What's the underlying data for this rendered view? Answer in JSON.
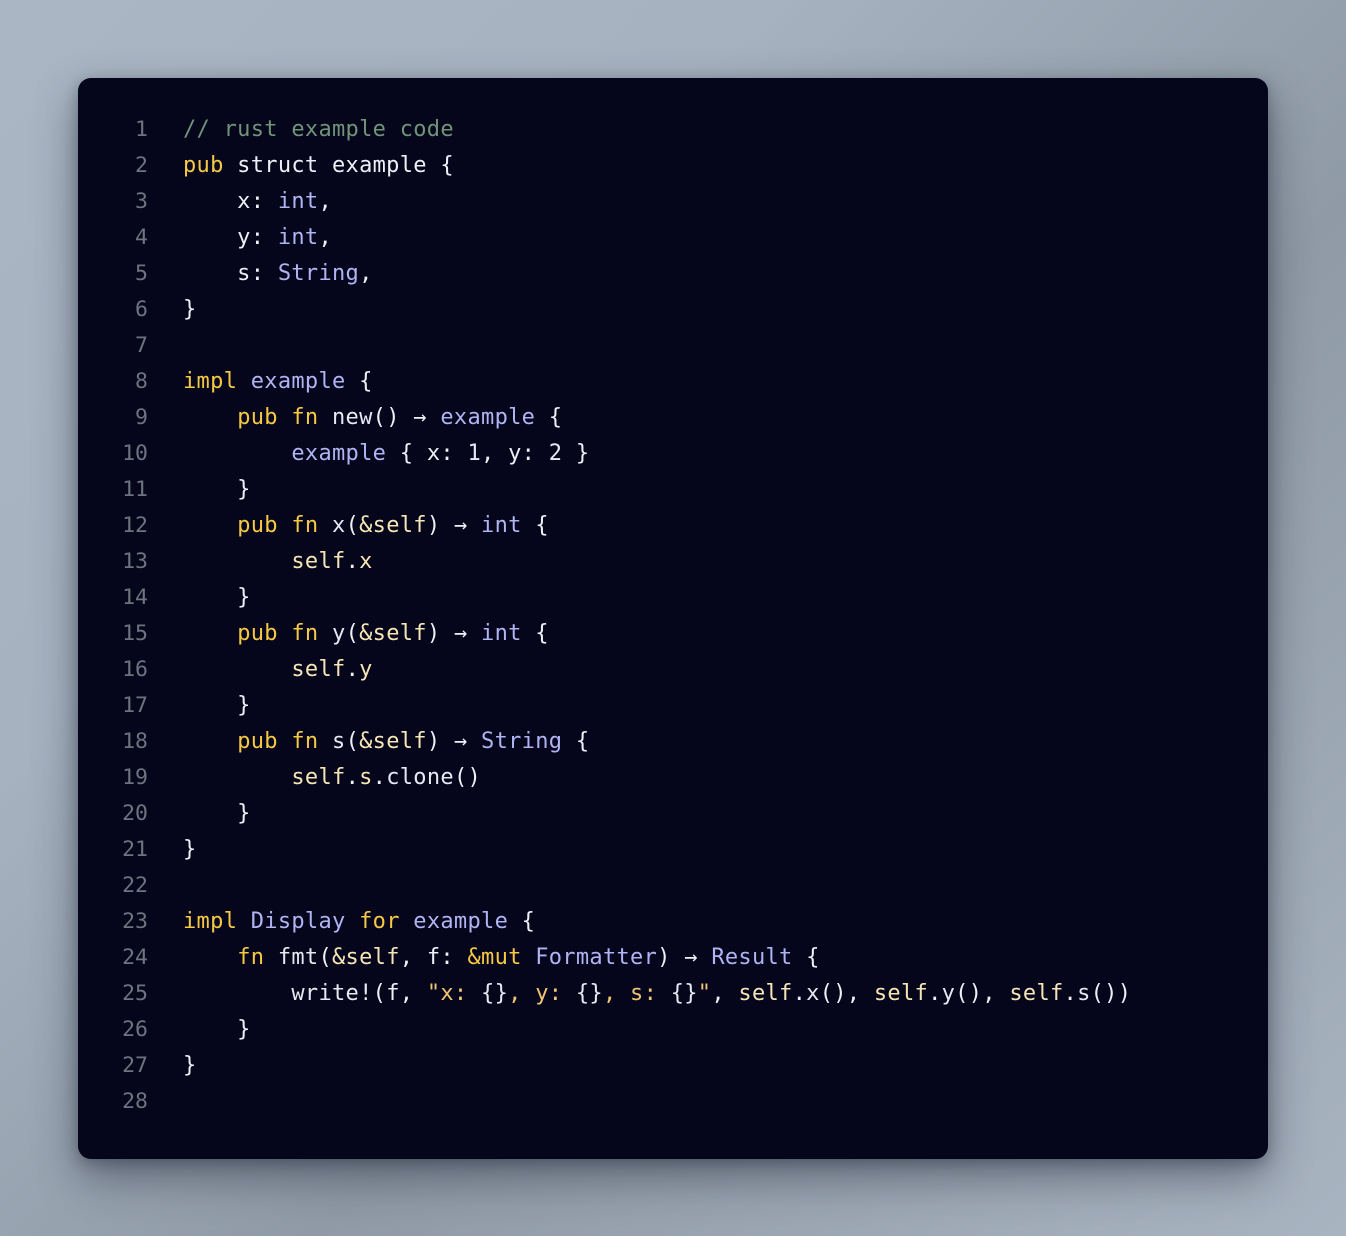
{
  "editor": {
    "language": "rust",
    "background": "#05051c",
    "page_background": "#a6b2c0",
    "gutter_color": "#6e747f",
    "total_lines": 28
  },
  "palette": {
    "comment": "#6f9478",
    "keyword": "#f6c944",
    "type": "#b0b4f2",
    "function": "#cdf3dc",
    "self": "#f6e6b6",
    "plain": "#eef0f6",
    "number": "#d9a521",
    "string": "#f0c674",
    "brace_placeholder": "#ffd040"
  },
  "lines": [
    {
      "n": "1",
      "tokens": [
        {
          "t": "// rust example code",
          "c": "comment"
        }
      ]
    },
    {
      "n": "2",
      "tokens": [
        {
          "t": "pub",
          "c": "keyword"
        },
        {
          "t": " struct example {",
          "c": "plain"
        }
      ]
    },
    {
      "n": "3",
      "tokens": [
        {
          "t": "    x: ",
          "c": "plain"
        },
        {
          "t": "int",
          "c": "type"
        },
        {
          "t": ",",
          "c": "plain"
        }
      ]
    },
    {
      "n": "4",
      "tokens": [
        {
          "t": "    y: ",
          "c": "plain"
        },
        {
          "t": "int",
          "c": "type"
        },
        {
          "t": ",",
          "c": "plain"
        }
      ]
    },
    {
      "n": "5",
      "tokens": [
        {
          "t": "    s: ",
          "c": "plain"
        },
        {
          "t": "String",
          "c": "type"
        },
        {
          "t": ",",
          "c": "plain"
        }
      ]
    },
    {
      "n": "6",
      "tokens": [
        {
          "t": "}",
          "c": "plain"
        }
      ]
    },
    {
      "n": "7",
      "tokens": []
    },
    {
      "n": "8",
      "tokens": [
        {
          "t": "impl",
          "c": "keyword"
        },
        {
          "t": " ",
          "c": "plain"
        },
        {
          "t": "example",
          "c": "type"
        },
        {
          "t": " {",
          "c": "plain"
        }
      ]
    },
    {
      "n": "9",
      "tokens": [
        {
          "t": "    ",
          "c": "plain"
        },
        {
          "t": "pub fn",
          "c": "keyword"
        },
        {
          "t": " ",
          "c": "plain"
        },
        {
          "t": "new",
          "c": "function"
        },
        {
          "t": "() ",
          "c": "plain"
        },
        {
          "t": "→",
          "c": "plain"
        },
        {
          "t": " ",
          "c": "plain"
        },
        {
          "t": "example",
          "c": "type"
        },
        {
          "t": " {",
          "c": "plain"
        }
      ]
    },
    {
      "n": "10",
      "tokens": [
        {
          "t": "        ",
          "c": "plain"
        },
        {
          "t": "example",
          "c": "type"
        },
        {
          "t": " { x: ",
          "c": "plain"
        },
        {
          "t": "1",
          "c": "number"
        },
        {
          "t": ", y: ",
          "c": "plain"
        },
        {
          "t": "2",
          "c": "number"
        },
        {
          "t": " }",
          "c": "plain"
        }
      ]
    },
    {
      "n": "11",
      "tokens": [
        {
          "t": "    }",
          "c": "plain"
        }
      ]
    },
    {
      "n": "12",
      "tokens": [
        {
          "t": "    ",
          "c": "plain"
        },
        {
          "t": "pub fn",
          "c": "keyword"
        },
        {
          "t": " ",
          "c": "plain"
        },
        {
          "t": "x",
          "c": "function"
        },
        {
          "t": "(",
          "c": "plain"
        },
        {
          "t": "&self",
          "c": "self"
        },
        {
          "t": ") ",
          "c": "plain"
        },
        {
          "t": "→",
          "c": "plain"
        },
        {
          "t": " ",
          "c": "plain"
        },
        {
          "t": "int",
          "c": "type"
        },
        {
          "t": " {",
          "c": "plain"
        }
      ]
    },
    {
      "n": "13",
      "tokens": [
        {
          "t": "        ",
          "c": "plain"
        },
        {
          "t": "self",
          "c": "self"
        },
        {
          "t": ".",
          "c": "plain"
        },
        {
          "t": "x",
          "c": "self"
        }
      ]
    },
    {
      "n": "14",
      "tokens": [
        {
          "t": "    }",
          "c": "plain"
        }
      ]
    },
    {
      "n": "15",
      "tokens": [
        {
          "t": "    ",
          "c": "plain"
        },
        {
          "t": "pub fn",
          "c": "keyword"
        },
        {
          "t": " ",
          "c": "plain"
        },
        {
          "t": "y",
          "c": "function"
        },
        {
          "t": "(",
          "c": "plain"
        },
        {
          "t": "&self",
          "c": "self"
        },
        {
          "t": ") ",
          "c": "plain"
        },
        {
          "t": "→",
          "c": "plain"
        },
        {
          "t": " ",
          "c": "plain"
        },
        {
          "t": "int",
          "c": "type"
        },
        {
          "t": " {",
          "c": "plain"
        }
      ]
    },
    {
      "n": "16",
      "tokens": [
        {
          "t": "        ",
          "c": "plain"
        },
        {
          "t": "self",
          "c": "self"
        },
        {
          "t": ".",
          "c": "plain"
        },
        {
          "t": "y",
          "c": "self"
        }
      ]
    },
    {
      "n": "17",
      "tokens": [
        {
          "t": "    }",
          "c": "plain"
        }
      ]
    },
    {
      "n": "18",
      "tokens": [
        {
          "t": "    ",
          "c": "plain"
        },
        {
          "t": "pub fn",
          "c": "keyword"
        },
        {
          "t": " ",
          "c": "plain"
        },
        {
          "t": "s",
          "c": "function"
        },
        {
          "t": "(",
          "c": "plain"
        },
        {
          "t": "&self",
          "c": "self"
        },
        {
          "t": ") ",
          "c": "plain"
        },
        {
          "t": "→",
          "c": "plain"
        },
        {
          "t": " ",
          "c": "plain"
        },
        {
          "t": "String",
          "c": "type"
        },
        {
          "t": " {",
          "c": "plain"
        }
      ]
    },
    {
      "n": "19",
      "tokens": [
        {
          "t": "        ",
          "c": "plain"
        },
        {
          "t": "self",
          "c": "self"
        },
        {
          "t": ".",
          "c": "plain"
        },
        {
          "t": "s",
          "c": "self"
        },
        {
          "t": ".",
          "c": "plain"
        },
        {
          "t": "clone",
          "c": "function"
        },
        {
          "t": "()",
          "c": "plain"
        }
      ]
    },
    {
      "n": "20",
      "tokens": [
        {
          "t": "    }",
          "c": "plain"
        }
      ]
    },
    {
      "n": "21",
      "tokens": [
        {
          "t": "}",
          "c": "plain"
        }
      ]
    },
    {
      "n": "22",
      "tokens": []
    },
    {
      "n": "23",
      "tokens": [
        {
          "t": "impl",
          "c": "keyword"
        },
        {
          "t": " ",
          "c": "plain"
        },
        {
          "t": "Display",
          "c": "type"
        },
        {
          "t": " ",
          "c": "plain"
        },
        {
          "t": "for",
          "c": "keyword"
        },
        {
          "t": " ",
          "c": "plain"
        },
        {
          "t": "example",
          "c": "type"
        },
        {
          "t": " {",
          "c": "plain"
        }
      ]
    },
    {
      "n": "24",
      "tokens": [
        {
          "t": "    ",
          "c": "plain"
        },
        {
          "t": "fn",
          "c": "keyword"
        },
        {
          "t": " ",
          "c": "plain"
        },
        {
          "t": "fmt",
          "c": "function"
        },
        {
          "t": "(",
          "c": "plain"
        },
        {
          "t": "&self",
          "c": "self"
        },
        {
          "t": ", f: ",
          "c": "plain"
        },
        {
          "t": "&mut",
          "c": "keyword"
        },
        {
          "t": " ",
          "c": "plain"
        },
        {
          "t": "Formatter",
          "c": "type"
        },
        {
          "t": ") ",
          "c": "plain"
        },
        {
          "t": "→",
          "c": "plain"
        },
        {
          "t": " ",
          "c": "plain"
        },
        {
          "t": "Result",
          "c": "type"
        },
        {
          "t": " {",
          "c": "plain"
        }
      ]
    },
    {
      "n": "25",
      "tokens": [
        {
          "t": "        ",
          "c": "plain"
        },
        {
          "t": "write!",
          "c": "function"
        },
        {
          "t": "(f, ",
          "c": "plain"
        },
        {
          "t": "\"x: ",
          "c": "string"
        },
        {
          "t": "{}",
          "c": "brace_placeholder"
        },
        {
          "t": ", y: ",
          "c": "string"
        },
        {
          "t": "{}",
          "c": "brace_placeholder"
        },
        {
          "t": ", s: ",
          "c": "string"
        },
        {
          "t": "{}",
          "c": "brace_placeholder"
        },
        {
          "t": "\"",
          "c": "string"
        },
        {
          "t": ", ",
          "c": "plain"
        },
        {
          "t": "self",
          "c": "self"
        },
        {
          "t": ".",
          "c": "plain"
        },
        {
          "t": "x",
          "c": "function"
        },
        {
          "t": "(), ",
          "c": "plain"
        },
        {
          "t": "self",
          "c": "self"
        },
        {
          "t": ".",
          "c": "plain"
        },
        {
          "t": "y",
          "c": "function"
        },
        {
          "t": "(), ",
          "c": "plain"
        },
        {
          "t": "self",
          "c": "self"
        },
        {
          "t": ".",
          "c": "plain"
        },
        {
          "t": "s",
          "c": "function"
        },
        {
          "t": "())",
          "c": "plain"
        }
      ]
    },
    {
      "n": "26",
      "tokens": [
        {
          "t": "    }",
          "c": "plain"
        }
      ]
    },
    {
      "n": "27",
      "tokens": [
        {
          "t": "}",
          "c": "plain"
        }
      ]
    },
    {
      "n": "28",
      "tokens": []
    }
  ]
}
